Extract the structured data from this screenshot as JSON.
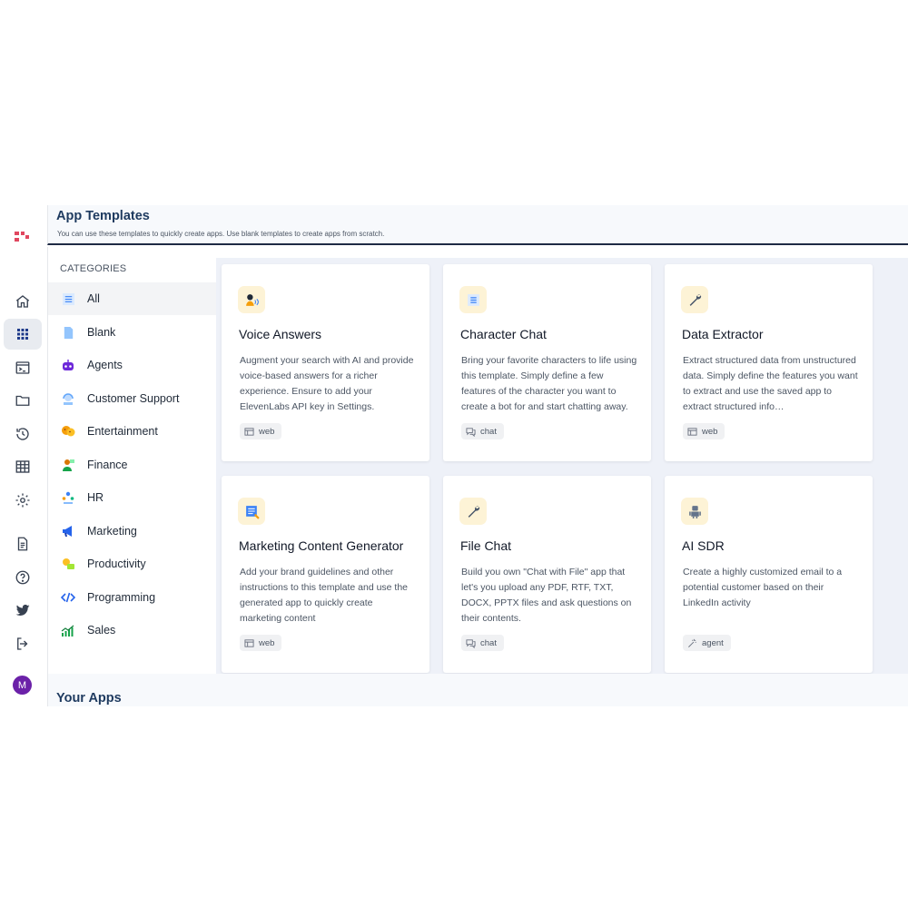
{
  "header": {
    "title": "App Templates",
    "subtitle": "You can use these templates to quickly create apps. Use blank templates to create apps from scratch."
  },
  "rail": {
    "icons": [
      "home-icon",
      "apps-grid-icon",
      "terminal-icon",
      "folder-icon",
      "history-icon",
      "table-icon",
      "settings-icon",
      "document-icon",
      "help-icon",
      "twitter-icon",
      "logout-icon"
    ],
    "avatar_initial": "M"
  },
  "categories": {
    "title": "CATEGORIES",
    "items": [
      {
        "label": "All",
        "icon": "all-icon",
        "active": true
      },
      {
        "label": "Blank",
        "icon": "blank-icon"
      },
      {
        "label": "Agents",
        "icon": "robot-icon"
      },
      {
        "label": "Customer Support",
        "icon": "support-icon"
      },
      {
        "label": "Entertainment",
        "icon": "masks-icon"
      },
      {
        "label": "Finance",
        "icon": "finance-icon"
      },
      {
        "label": "HR",
        "icon": "hr-icon"
      },
      {
        "label": "Marketing",
        "icon": "megaphone-icon"
      },
      {
        "label": "Productivity",
        "icon": "productivity-icon"
      },
      {
        "label": "Programming",
        "icon": "code-icon"
      },
      {
        "label": "Sales",
        "icon": "chart-icon"
      }
    ]
  },
  "templates": [
    {
      "title": "Voice Answers",
      "icon": "voice-icon",
      "description": "Augment your search with AI and provide voice-based answers for a richer experience. Ensure to add your ElevenLabs API key in Settings.",
      "tag": "web"
    },
    {
      "title": "Character Chat",
      "icon": "character-icon",
      "description": "Bring your favorite characters to life using this template. Simply define a few features of the character you want to create a bot for and start chatting away.",
      "tag": "chat"
    },
    {
      "title": "Data Extractor",
      "icon": "wrench-icon",
      "description": "Extract structured data from unstructured data. Simply define the features you want to extract and use the saved app to extract structured info…",
      "tag": "web"
    },
    {
      "title": "Marketing Content Generator",
      "icon": "content-icon",
      "description": "Add your brand guidelines and other instructions to this template and use the generated app to quickly create marketing content",
      "tag": "web"
    },
    {
      "title": "File Chat",
      "icon": "wrench-icon",
      "description": "Build you own \"Chat with File\" app that let's you upload any PDF, RTF, TXT, DOCX, PPTX files and ask questions on their contents.",
      "tag": "chat"
    },
    {
      "title": "AI SDR",
      "icon": "robot-icon",
      "description": "Create a highly customized email to a potential customer based on their LinkedIn activity",
      "tag": "agent"
    }
  ],
  "your_apps": {
    "title": "Your Apps"
  }
}
